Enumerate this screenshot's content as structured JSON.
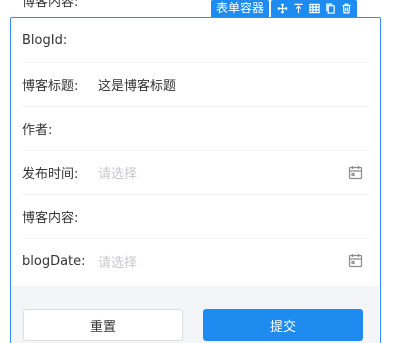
{
  "peek_label": "博客内容:",
  "toolbar": {
    "title": "表单容器",
    "actions": [
      {
        "icon": "move-icon"
      },
      {
        "icon": "align-top-icon"
      },
      {
        "icon": "grid-icon"
      },
      {
        "icon": "copy-icon"
      },
      {
        "icon": "trash-icon"
      }
    ]
  },
  "form": {
    "rows": [
      {
        "label": "BlogId:",
        "value": ""
      },
      {
        "label": "博客标题:",
        "value": "这是博客标题"
      },
      {
        "label": "作者:",
        "value": ""
      },
      {
        "label": "发布时间:",
        "placeholder": "请选择",
        "icon": "calendar-icon"
      },
      {
        "label": "博客内容:",
        "value": ""
      },
      {
        "label": "blogDate:",
        "placeholder": "请选择",
        "icon": "calendar-icon"
      }
    ]
  },
  "buttons": {
    "reset": "重置",
    "submit": "提交"
  },
  "colors": {
    "primary": "#1e8bf0",
    "border": "#2e8ff0",
    "placeholder": "#c8c9cc",
    "background_gray": "#f4f5f7"
  }
}
